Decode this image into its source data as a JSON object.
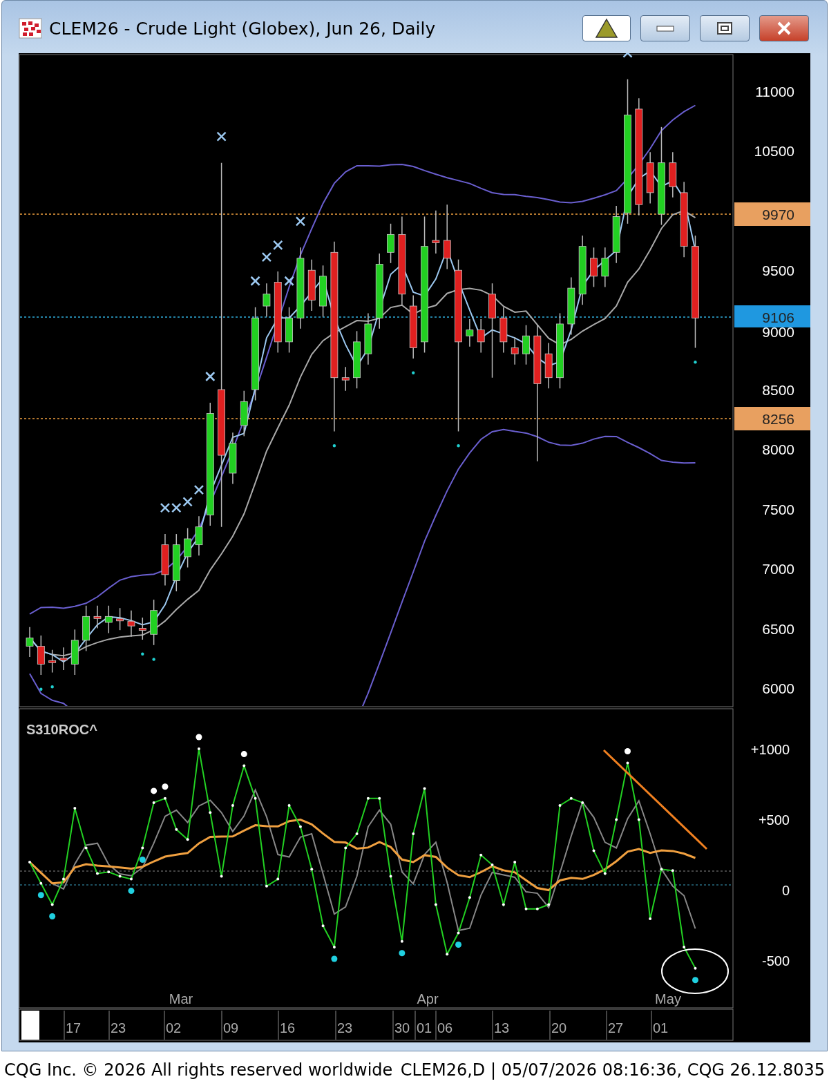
{
  "window": {
    "title": "CLEM26 - Crude Light (Globex), Jun 26, Daily"
  },
  "price_axis": {
    "labels": [
      "11000",
      "10500",
      "9500",
      "9000",
      "8500",
      "8000",
      "7500",
      "7000",
      "6500",
      "6000"
    ]
  },
  "price_markers": [
    {
      "label": "9970",
      "kind": "resistance"
    },
    {
      "label": "9106",
      "kind": "last"
    },
    {
      "label": "8256",
      "kind": "resistance"
    }
  ],
  "indicator": {
    "title": "S310ROC^",
    "axis_labels": [
      "+1000",
      "+500",
      "0",
      "-500"
    ]
  },
  "time_axis": {
    "months": [
      "Mar",
      "Apr",
      "May"
    ],
    "days": [
      "17",
      "23",
      "02",
      "09",
      "16",
      "23",
      "30",
      "01",
      "06",
      "13",
      "20",
      "27",
      "01"
    ]
  },
  "status_bar": {
    "left": "CQG Inc. © 2026 All rights reserved worldwide",
    "right": "CLEM26,D | 05/07/2026 08:16:36, CQG 26.12.8035"
  }
}
